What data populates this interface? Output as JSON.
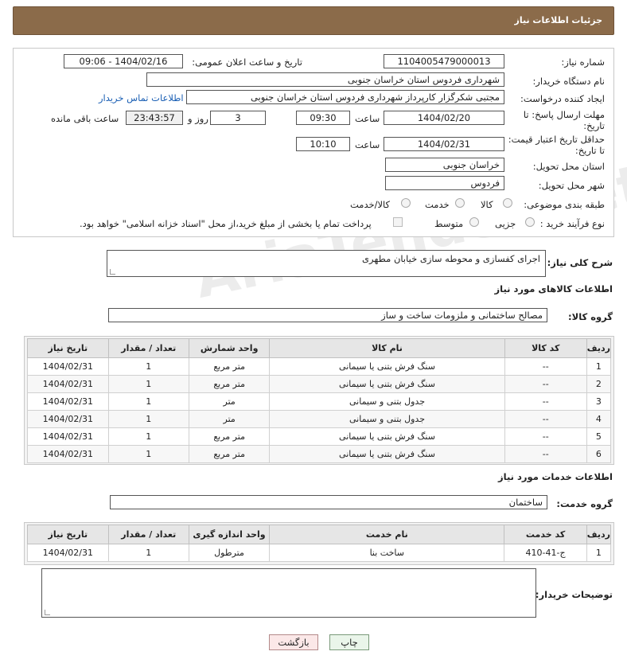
{
  "header": {
    "title": "جزئیات اطلاعات نیاز"
  },
  "form": {
    "need_number_label": "شماره نیاز:",
    "need_number": "1104005479000013",
    "announce_label": "تاریخ و ساعت اعلان عمومی:",
    "announce_value": "1404/02/16 - 09:06",
    "buyer_label": "نام دستگاه خریدار:",
    "buyer_value": "شهرداری فردوس استان خراسان جنوبی",
    "creator_label": "ایجاد کننده درخواست:",
    "creator_value": "مجتبی شکرگزار کارپرداز شهرداری فردوس استان خراسان جنوبی",
    "contact_link": "اطلاعات تماس خریدار",
    "deadline_label_1": "مهلت ارسال پاسخ: تا",
    "deadline_label_2": "تاریخ:",
    "deadline_date": "1404/02/20",
    "time_label": "ساعت",
    "deadline_time": "09:30",
    "days_value": "3",
    "days_label": "روز و",
    "remaining_value": "23:43:57",
    "remaining_label": "ساعت باقی مانده",
    "validity_label_1": "حداقل تاریخ اعتبار قیمت:",
    "validity_label_2": "تا تاریخ:",
    "validity_date": "1404/02/31",
    "validity_time": "10:10",
    "province_label": "استان محل تحویل:",
    "province_value": "خراسان جنوبی",
    "city_label": "شهر محل تحویل:",
    "city_value": "فردوس",
    "category_label": "طبقه بندی موضوعی:",
    "category_options": [
      "کالا",
      "خدمت",
      "کالا/خدمت"
    ],
    "process_label": "نوع فرآیند خرید :",
    "process_options": [
      "جزیی",
      "متوسط"
    ],
    "payment_note": "پرداخت تمام یا بخشی از مبلغ خرید،از محل \"اسناد خزانه اسلامی\" خواهد بود."
  },
  "description": {
    "label": "شرح کلی نیاز:",
    "value": "اجرای کفسازی و محوطه سازی خیابان مطهری"
  },
  "goods": {
    "section_title": "اطلاعات کالاهای مورد نیاز",
    "group_label": "گروه کالا:",
    "group_value": "مصالح ساختمانی و ملزومات ساخت و ساز",
    "columns": [
      "ردیف",
      "کد کالا",
      "نام کالا",
      "واحد شمارش",
      "تعداد / مقدار",
      "تاریخ نیاز"
    ],
    "rows": [
      [
        "1",
        "--",
        "سنگ فرش بتنی یا سیمانی",
        "متر مربع",
        "1",
        "1404/02/31"
      ],
      [
        "2",
        "--",
        "سنگ فرش بتنی یا سیمانی",
        "متر مربع",
        "1",
        "1404/02/31"
      ],
      [
        "3",
        "--",
        "جدول بتنی و سیمانی",
        "متر",
        "1",
        "1404/02/31"
      ],
      [
        "4",
        "--",
        "جدول بتنی و سیمانی",
        "متر",
        "1",
        "1404/02/31"
      ],
      [
        "5",
        "--",
        "سنگ فرش بتنی یا سیمانی",
        "متر مربع",
        "1",
        "1404/02/31"
      ],
      [
        "6",
        "--",
        "سنگ فرش بتنی یا سیمانی",
        "متر مربع",
        "1",
        "1404/02/31"
      ]
    ]
  },
  "services": {
    "section_title": "اطلاعات خدمات مورد نیاز",
    "group_label": "گروه خدمت:",
    "group_value": "ساختمان",
    "columns": [
      "ردیف",
      "کد خدمت",
      "نام خدمت",
      "واحد اندازه گیری",
      "تعداد / مقدار",
      "تاریخ نیاز"
    ],
    "rows": [
      [
        "1",
        "ج-41-410",
        "ساخت بنا",
        "مترطول",
        "1",
        "1404/02/31"
      ]
    ]
  },
  "buyer_notes": {
    "label": "توضیحات خریدار:",
    "value": ""
  },
  "buttons": {
    "print": "چاپ",
    "back": "بازگشت"
  },
  "watermark": "AriaTender.net"
}
